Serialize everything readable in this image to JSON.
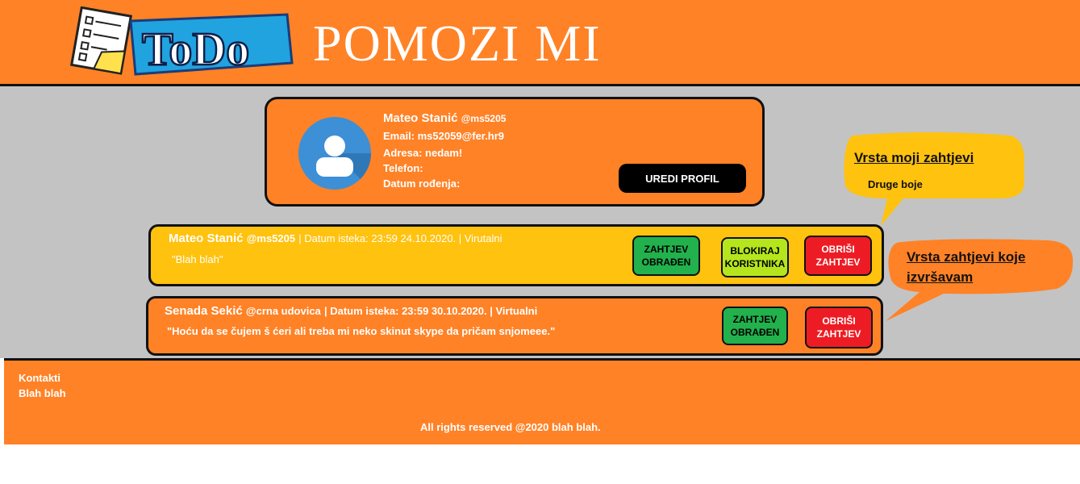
{
  "header": {
    "logo_text": "ToDo",
    "title": "POMOZI MI"
  },
  "profile": {
    "name": "Mateo Stanić",
    "handle": "@ms5205",
    "email": "Email: ms52059@fer.hr9",
    "address": "Adresa: nedam!",
    "phone": "Telefon:",
    "birthdate": "Datum rođenja:",
    "edit_button": "UREDI PROFIL"
  },
  "requests": [
    {
      "user": "Mateo Stanić",
      "handle": "@ms5205",
      "meta": "| Datum isteka: 23:59 24.10.2020. | Virutalni",
      "text": "\"Blah blah\"",
      "btn_done": [
        "ZAHTJEV",
        "OBRAĐEN"
      ],
      "btn_block": [
        "BLOKIRAJ",
        "KORISTNIKA"
      ],
      "btn_delete": [
        "OBRIŠI",
        "ZAHTJEV"
      ],
      "color": "#ffc20e"
    },
    {
      "user": "Senada Sekić",
      "handle": "@crna udovica",
      "meta": "| Datum isteka: 23:59 30.10.2020. | Virtualni",
      "text": "\"Hoću da se čujem š ćeri ali treba mi neko skinut skype da pričam snjomeee.\"",
      "btn_done": [
        "ZAHTJEV",
        "OBRAĐEN"
      ],
      "btn_delete": [
        "OBRIŠI",
        "ZAHTJEV"
      ],
      "color": "#ff8226"
    }
  ],
  "annotations": {
    "yellow_title": "Vrsta moji zahtjevi",
    "yellow_sub": "Druge boje",
    "orange_line1": "Vrsta zahtjevi koje",
    "orange_line2": "izvršavam"
  },
  "footer": {
    "contacts": "Kontakti",
    "contacts_sub": "Blah blah",
    "copyright": "All rights reserved @2020 blah blah."
  },
  "colors": {
    "orange": "#ff8226",
    "yellow": "#ffc20e",
    "gray": "#c3c3c3",
    "green": "#22b14c",
    "lime": "#b5e61d",
    "red": "#ed1c24",
    "avatar_blue": "#3d8fd6"
  }
}
